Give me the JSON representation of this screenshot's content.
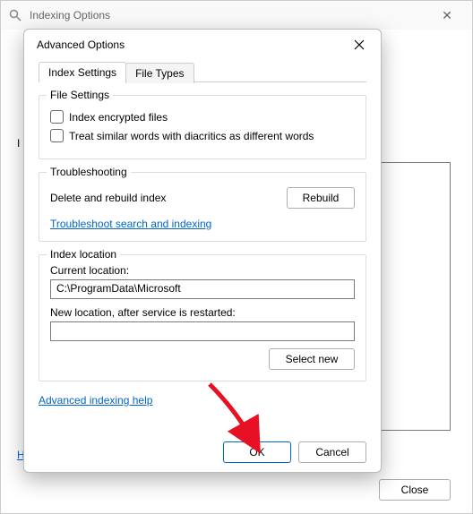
{
  "parent": {
    "title": "Indexing Options",
    "side_label": "I",
    "h": "H",
    "close": "Close"
  },
  "modal": {
    "title": "Advanced Options",
    "tabs": {
      "settings": "Index Settings",
      "filetypes": "File Types"
    },
    "file_settings": {
      "legend": "File Settings",
      "encrypted": "Index encrypted files",
      "diacritics": "Treat similar words with diacritics as different words"
    },
    "troubleshooting": {
      "legend": "Troubleshooting",
      "desc": "Delete and rebuild index",
      "rebuild": "Rebuild",
      "link": "Troubleshoot search and indexing"
    },
    "index_location": {
      "legend": "Index location",
      "current_label": "Current location:",
      "current_value": "C:\\ProgramData\\Microsoft",
      "new_label": "New location, after service is restarted:",
      "new_value": "",
      "select_new": "Select new"
    },
    "help_link": "Advanced indexing help",
    "ok": "OK",
    "cancel": "Cancel"
  }
}
